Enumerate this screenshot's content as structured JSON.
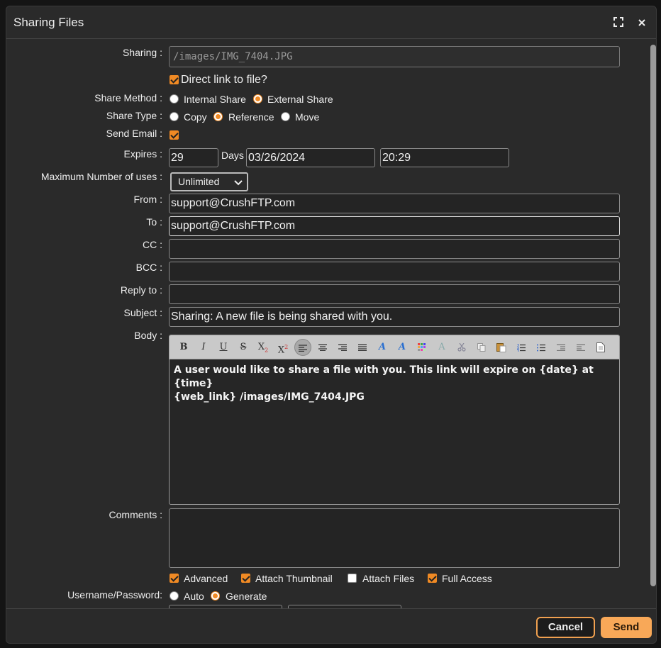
{
  "title": "Sharing Files",
  "labels": {
    "sharing": "Sharing :",
    "share_method": "Share Method :",
    "share_type": "Share Type :",
    "send_email": "Send Email :",
    "expires": "Expires :",
    "max_uses": "Maximum Number of uses :",
    "from": "From :",
    "to": "To :",
    "cc": "CC :",
    "bcc": "BCC :",
    "reply_to": "Reply to :",
    "subject": "Subject :",
    "body": "Body :",
    "comments": "Comments :",
    "username_password": "Username/Password:"
  },
  "sharing_path": "/images/IMG_7404.JPG",
  "direct_link": {
    "label": "Direct link to file?",
    "checked": true
  },
  "share_method": {
    "options": [
      "Internal Share",
      "External Share"
    ],
    "selected": "External Share"
  },
  "share_type": {
    "options": [
      "Copy",
      "Reference",
      "Move"
    ],
    "selected": "Reference"
  },
  "send_email_checked": true,
  "expires": {
    "days": "29",
    "days_label": "Days",
    "date": "03/26/2024",
    "time": "20:29"
  },
  "max_uses": "Unlimited",
  "from": "support@CrushFTP.com",
  "to": "support@CrushFTP.com",
  "cc": "",
  "bcc": "",
  "reply_to": "",
  "subject": "Sharing: A new file is being shared with you.",
  "body_lines": [
    "A user would like to share a file with you. This link will expire on {date} at {time}",
    "{web_link} /images/IMG_7404.JPG"
  ],
  "toolbar_icons": [
    "bold-icon",
    "italic-icon",
    "underline-icon",
    "strikethrough-icon",
    "subscript-icon",
    "superscript-icon",
    "align-left-icon",
    "align-center-icon",
    "align-right-icon",
    "align-justify-icon",
    "text-color-icon",
    "background-color-icon",
    "color-picker-icon",
    "remove-format-icon",
    "cut-icon",
    "copy-icon",
    "paste-icon",
    "ordered-list-icon",
    "unordered-list-icon",
    "outdent-icon",
    "indent-icon",
    "source-icon"
  ],
  "comments": "",
  "options": {
    "advanced": {
      "label": "Advanced",
      "checked": true
    },
    "attach_thumbnail": {
      "label": "Attach Thumbnail",
      "checked": true
    },
    "attach_files": {
      "label": "Attach Files",
      "checked": false
    },
    "full_access": {
      "label": "Full Access",
      "checked": true
    }
  },
  "username_password": {
    "options": [
      "Auto",
      "Generate"
    ],
    "selected": "Generate"
  },
  "buttons": {
    "cancel": "Cancel",
    "send": "Send"
  },
  "colors": {
    "accent": "#f08a24",
    "send_button": "#f8a858",
    "dialog_bg": "#2a2a2a"
  }
}
